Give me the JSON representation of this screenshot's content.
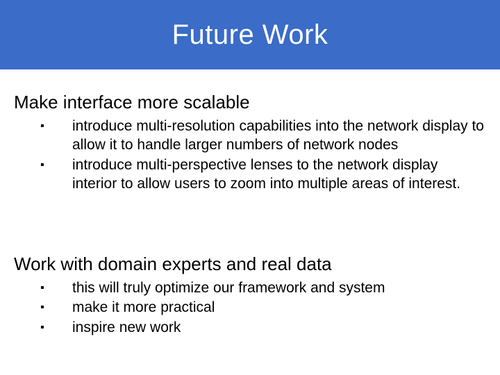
{
  "title": "Future Work",
  "sections": [
    {
      "heading": "Make interface more scalable",
      "bullets": [
        "introduce multi-resolution capabilities into the network display to allow it to handle larger numbers of network nodes",
        "introduce multi-perspective lenses to the network display interior to allow users to zoom into multiple areas of interest."
      ]
    },
    {
      "heading": "Work with domain experts and real data",
      "bullets": [
        "this will truly optimize our framework and system",
        "make it more practical",
        "inspire new work"
      ]
    }
  ]
}
